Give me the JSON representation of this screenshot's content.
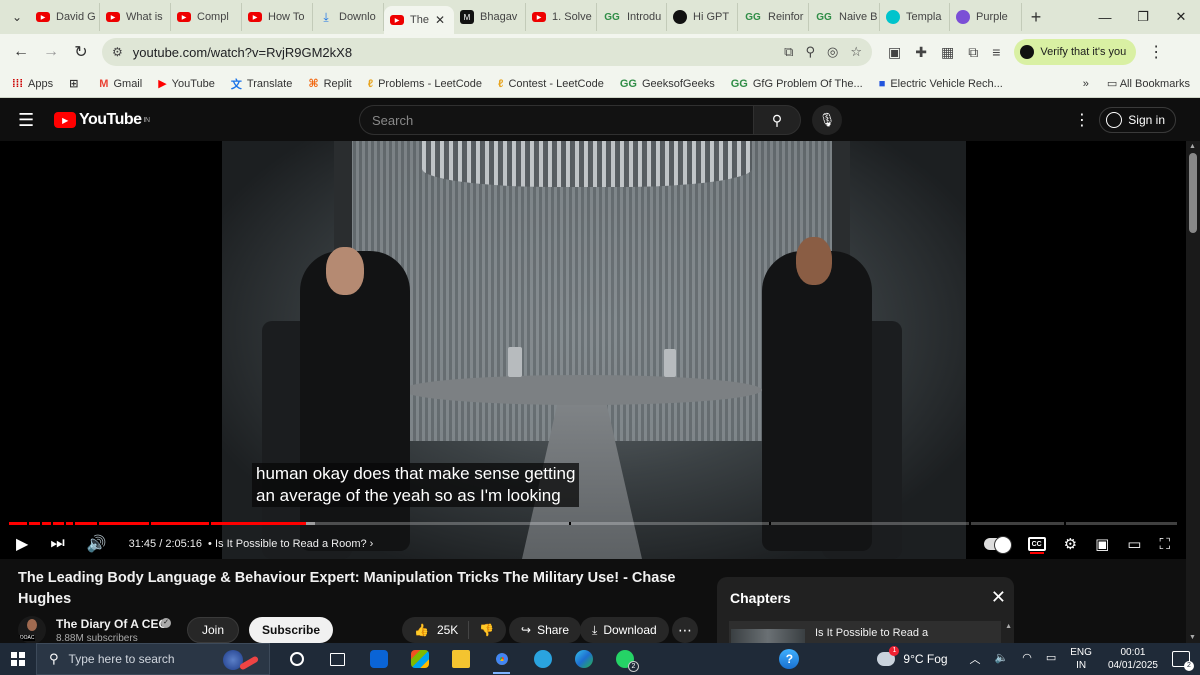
{
  "browser": {
    "tabs": [
      {
        "label": "David G",
        "icon": "youtube-icon"
      },
      {
        "label": "What is",
        "icon": "youtube-icon"
      },
      {
        "label": "Compl",
        "icon": "youtube-icon"
      },
      {
        "label": "How To",
        "icon": "youtube-icon"
      },
      {
        "label": "Downlo",
        "icon": "download-icon"
      },
      {
        "label": "The",
        "icon": "youtube-icon",
        "active": true
      },
      {
        "label": "Bhagav",
        "icon": "medium-icon"
      },
      {
        "label": "1. Solve",
        "icon": "youtube-icon"
      },
      {
        "label": "Introdu",
        "icon": "gfg-icon"
      },
      {
        "label": "Hi GPT",
        "icon": "chatgpt-icon"
      },
      {
        "label": "Reinfor",
        "icon": "gfg-icon"
      },
      {
        "label": "Naive B",
        "icon": "gfg-icon"
      },
      {
        "label": "Templa",
        "icon": "canva-icon"
      },
      {
        "label": "Purple",
        "icon": "purple-icon"
      }
    ],
    "url": "youtube.com/watch?v=RvjR9GM2kX8",
    "verify_label": "Verify that it's you",
    "bookmarks": [
      {
        "label": "Apps",
        "icon": "apps-grid-icon"
      },
      {
        "label": "",
        "icon": "grid-icon"
      },
      {
        "label": "Gmail",
        "icon": "gmail-icon"
      },
      {
        "label": "YouTube",
        "icon": "youtube-icon"
      },
      {
        "label": "Translate",
        "icon": "translate-icon"
      },
      {
        "label": "Replit",
        "icon": "replit-icon"
      },
      {
        "label": "Problems - LeetCode",
        "icon": "leetcode-icon"
      },
      {
        "label": "Contest - LeetCode",
        "icon": "leetcode-icon"
      },
      {
        "label": "GeeksofGeeks",
        "icon": "gfg-icon"
      },
      {
        "label": "GfG Problem Of The...",
        "icon": "gfg-icon"
      },
      {
        "label": "Electric Vehicle Rech...",
        "icon": "bookmark-blue-icon"
      }
    ],
    "all_bookmarks": "All Bookmarks"
  },
  "youtube": {
    "logo_text": "YouTube",
    "region": "IN",
    "search_placeholder": "Search",
    "sign_in": "Sign in"
  },
  "player": {
    "captions": [
      "human okay does that make sense getting",
      "an average of the yeah so as I'm looking"
    ],
    "time_current": "31:45",
    "time_total": "2:05:16",
    "chapter": "Is It Possible to Read a Room?",
    "progress_played": 0.254,
    "progress_buffered": 0.262,
    "cc_label": "CC"
  },
  "video": {
    "title": "The Leading Body Language & Behaviour Expert: Manipulation Tricks The Military Use! - Chase Hughes",
    "channel": "The Diary Of A CEO",
    "subscribers": "8.88M subscribers",
    "join": "Join",
    "subscribe": "Subscribe",
    "likes": "25K",
    "share": "Share",
    "download": "Download"
  },
  "chapters": {
    "heading": "Chapters",
    "first_item": "Is It Possible to Read a"
  },
  "taskbar": {
    "search_placeholder": "Type here to search",
    "weather": "9°C Fog",
    "lang_top": "ENG",
    "lang_bottom": "IN",
    "time": "00:01",
    "date": "04/01/2025",
    "whatsapp_badge": "2"
  }
}
